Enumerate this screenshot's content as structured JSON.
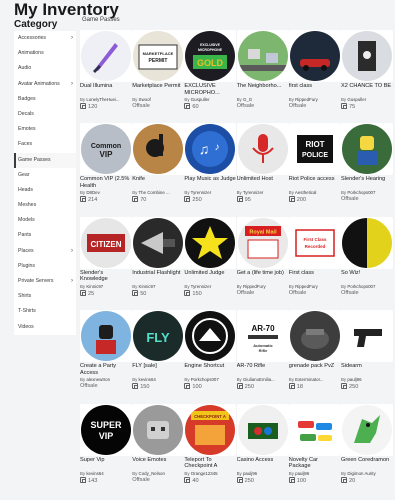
{
  "page_title": "My Inventory",
  "category_heading": "Category",
  "section_label": "Game Passes",
  "sidebar": [
    {
      "label": "Accessories",
      "chevron": true
    },
    {
      "label": "Animations",
      "chevron": false
    },
    {
      "label": "Audio",
      "chevron": false
    },
    {
      "label": "Avatar Animations",
      "chevron": true
    },
    {
      "label": "Badges",
      "chevron": false
    },
    {
      "label": "Decals",
      "chevron": false
    },
    {
      "label": "Emotes",
      "chevron": false
    },
    {
      "label": "Faces",
      "chevron": false
    },
    {
      "label": "Game Passes",
      "chevron": false,
      "active": true
    },
    {
      "label": "Gear",
      "chevron": false
    },
    {
      "label": "Heads",
      "chevron": false
    },
    {
      "label": "Meshes",
      "chevron": false
    },
    {
      "label": "Models",
      "chevron": false
    },
    {
      "label": "Pants",
      "chevron": false
    },
    {
      "label": "Places",
      "chevron": true
    },
    {
      "label": "Plugins",
      "chevron": false
    },
    {
      "label": "Private Servers",
      "chevron": true
    },
    {
      "label": "Shirts",
      "chevron": false
    },
    {
      "label": "T-Shirts",
      "chevron": false
    },
    {
      "label": "Videos",
      "chevron": false
    }
  ],
  "items": [
    {
      "name": "Dual Illumina",
      "by": "By",
      "creator": "LonelyTheHuei...",
      "price": "120",
      "thumb": "sword"
    },
    {
      "name": "Marketplace Permit",
      "by": "By",
      "creator": "Swoof",
      "price": "Offsale",
      "thumb": "permit"
    },
    {
      "name": "EXCLUSIVE MICROPHO...",
      "by": "By",
      "creator": "Guspuller",
      "price": "60",
      "thumb": "microphone-gold"
    },
    {
      "name": "The Neighborho...",
      "by": "By",
      "creator": "G_G",
      "price": "Offsale",
      "thumb": "town"
    },
    {
      "name": "first class",
      "by": "By",
      "creator": "RippedFury",
      "price": "Offsale",
      "thumb": "car-night"
    },
    {
      "name": "X2 CHANCE TO BE",
      "by": "By",
      "creator": "Guspuller",
      "price": "75",
      "thumb": "x2"
    },
    {
      "name": "Common VIP (2.5% Health",
      "by": "By",
      "creator": "D8Dev",
      "price": "214",
      "thumb": "common-vip"
    },
    {
      "name": "Knife",
      "by": "By",
      "creator": "The Combine ...",
      "price": "70",
      "thumb": "knife"
    },
    {
      "name": "Play Music as Judge",
      "by": "By",
      "creator": "Tyrennizer",
      "price": "250",
      "thumb": "music"
    },
    {
      "name": "Unlimited Host",
      "by": "By",
      "creator": "Tyrennizer",
      "price": "95",
      "thumb": "mic-red"
    },
    {
      "name": "Riot Police access",
      "by": "By",
      "creator": "Aesthetical",
      "price": "200",
      "thumb": "riot"
    },
    {
      "name": "Slender's Hearing",
      "by": "By",
      "creator": "Porkchops007",
      "price": "Offsale",
      "thumb": "noob"
    },
    {
      "name": "Slender's Knowledge",
      "by": "By",
      "creator": "Kinnic97",
      "price": "25",
      "thumb": "citizen"
    },
    {
      "name": "Industrial Flashlight",
      "by": "By",
      "creator": "Kinnic97",
      "price": "50",
      "thumb": "flashlight"
    },
    {
      "name": "Unlimited Judge",
      "by": "By",
      "creator": "Tyrennizer",
      "price": "150",
      "thumb": "star"
    },
    {
      "name": "Get a (life time job)",
      "by": "By",
      "creator": "RippedFury",
      "price": "Offsale",
      "thumb": "royal-mail"
    },
    {
      "name": "First class",
      "by": "By",
      "creator": "RippedFury",
      "price": "Offsale",
      "thumb": "first-class"
    },
    {
      "name": "So Wiz!",
      "by": "By",
      "creator": "Porkchops007",
      "price": "Offsale",
      "thumb": "half-yellow"
    },
    {
      "name": "Create a Party Access",
      "by": "By",
      "creator": "alexnewtron",
      "price": "Offsale",
      "thumb": "party"
    },
    {
      "name": "FLY [sale]",
      "by": "By",
      "creator": "kevins64",
      "price": "150",
      "thumb": "fly"
    },
    {
      "name": "Engine Shortcut",
      "by": "By",
      "creator": "Porkchops007",
      "price": "100",
      "thumb": "engine"
    },
    {
      "name": "AR-70 Rifle",
      "by": "By",
      "creator": "GiulianoEmilia...",
      "price": "250",
      "thumb": "ar70"
    },
    {
      "name": "grenade pack PvZ",
      "by": "By",
      "creator": "Exterminator...",
      "price": "18",
      "thumb": "grenade"
    },
    {
      "name": "Sidearm",
      "by": "By",
      "creator": "paulj96",
      "price": "250",
      "thumb": "pistol"
    },
    {
      "name": "Super Vip",
      "by": "By",
      "creator": "kevins64",
      "price": "143",
      "thumb": "super-vip"
    },
    {
      "name": "Voice Emotes",
      "by": "By",
      "creator": "Cody_Nelson",
      "price": "Offsale",
      "thumb": "voice"
    },
    {
      "name": "Teleport To Checkpoint A",
      "by": "By",
      "creator": "Orange12345",
      "price": "40",
      "thumb": "checkpoint"
    },
    {
      "name": "Casino Access",
      "by": "By",
      "creator": "paulj96",
      "price": "250",
      "thumb": "casino"
    },
    {
      "name": "Novelty Car Package",
      "by": "By",
      "creator": "paulj96",
      "price": "100",
      "thumb": "cars"
    },
    {
      "name": "Green Coredramon",
      "by": "By",
      "creator": "Digimon Aurity",
      "price": "20",
      "thumb": "dragon"
    }
  ],
  "thumb_text": {
    "permit": "MARKETPLACE PERMIT",
    "microphone-gold": "EXCLUSIVE MICROPHONE",
    "gold": "GOLD",
    "common-vip": "Common VIP",
    "riot": "RIOT POLICE",
    "citizen": "CITIZEN",
    "royal-mail": "Royal Mail",
    "first-class": "First Class Recorded",
    "fly": "FLY",
    "ar70": "AR-70",
    "ar70-sub": "Automatic Rifle",
    "super-vip": "SUPER VIP",
    "checkpoint": "CHECKPOINT A"
  },
  "colors": {
    "page_bg": "#f2f4f5",
    "card_bg": "#ffffff",
    "text_dark": "#191919",
    "text_muted": "#606162"
  }
}
